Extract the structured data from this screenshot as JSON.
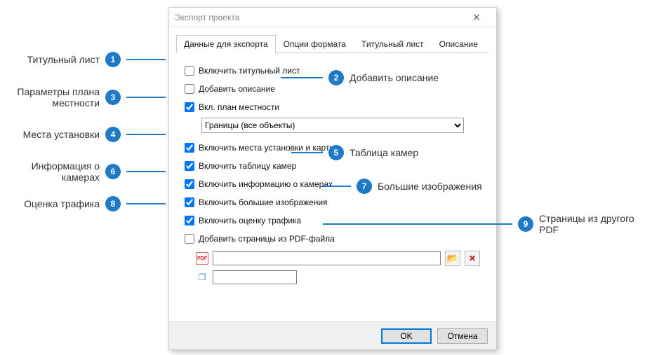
{
  "window": {
    "title": "Экспорт проекта"
  },
  "tabs": {
    "data": "Данные для экспорта",
    "format": "Опции формата",
    "title_page": "Титульный лист",
    "description": "Описание"
  },
  "checkboxes": {
    "title_page": "Включить титульный лист",
    "add_description": "Добавить описание",
    "layout_plan": "Вкл. план местности",
    "install_places": "Включить места установки и карту",
    "camera_table": "Включить таблицу камер",
    "camera_info": "Включить информацию о камерах",
    "large_images": "Включить большие изображения",
    "traffic": "Включить оценку трафика",
    "add_pdf": "Добавить страницы из PDF-файла"
  },
  "plan_select": {
    "value": "Границы (все объекты)"
  },
  "buttons": {
    "ok": "OK",
    "cancel": "Отмена"
  },
  "callouts": {
    "1": "Титульный лист",
    "2": "Добавить описание",
    "3": "Параметры плана местности",
    "4": "Места установки",
    "5": "Таблица камер",
    "6": "Информация о камерах",
    "7": "Большие изображения",
    "8": "Оценка трафика",
    "9": "Страницы из другого PDF"
  }
}
